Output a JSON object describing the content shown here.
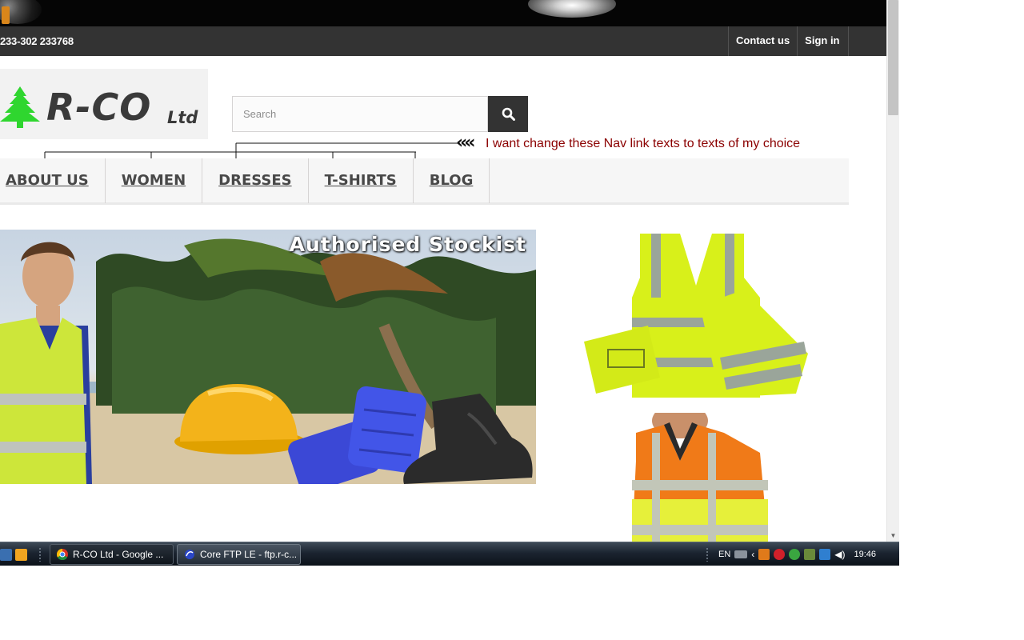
{
  "header": {
    "phone": "233-302 233768",
    "top_links": [
      "Contact us",
      "Sign in"
    ]
  },
  "logo": {
    "main": "R-CO",
    "suffix": "Ltd",
    "alt": "R-CO Ltd logo"
  },
  "search": {
    "placeholder": "Search"
  },
  "annotation": {
    "arrow": "«« ",
    "text": "I want change these Nav link texts to texts of my choice"
  },
  "menu": {
    "items": [
      "ABOUT US",
      "WOMEN",
      "DRESSES",
      "T-SHIRTS",
      "BLOG"
    ]
  },
  "hero": {
    "title": "Authorised Stockist"
  },
  "taskbar": {
    "windows": [
      "R-CO Ltd - Google ...",
      "Core FTP LE - ftp.r-c..."
    ],
    "language": "EN",
    "clock": "19:46"
  },
  "colors": {
    "top_bar": "#050505",
    "info_bar": "#333333",
    "annotation": "#8b0000",
    "menu_bg": "#f6f6f6",
    "menu_text": "#484848",
    "logo_green": "#2fd62f",
    "hi_vis_yellow": "#d8f01a",
    "hi_vis_orange": "#f07a18"
  }
}
